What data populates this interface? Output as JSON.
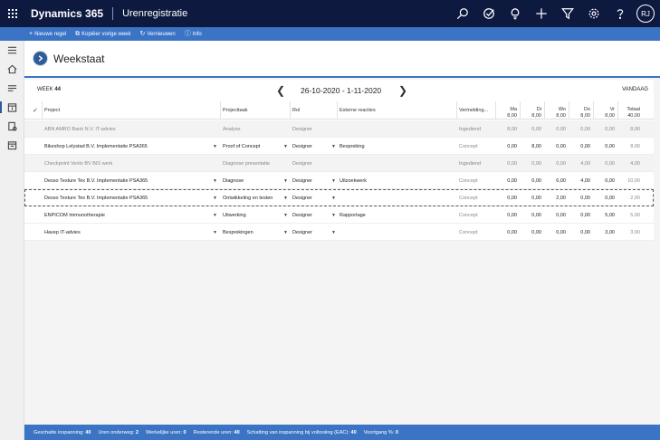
{
  "topbar": {
    "brand": "Dynamics 365",
    "app_name": "Urenregistratie",
    "avatar_initials": "RJ",
    "bg_color": "#0e1940"
  },
  "commands": [
    {
      "icon": "plus-icon",
      "label": "Nieuwe regel"
    },
    {
      "icon": "copy-icon",
      "label": "Kopiëer vorige week"
    },
    {
      "icon": "refresh-icon",
      "label": "Vernieuwen"
    },
    {
      "icon": "info-icon",
      "label": "Info"
    }
  ],
  "page": {
    "title": "Weekstaat",
    "accent_color": "#3b73c5"
  },
  "week": {
    "label": "WEEK",
    "number": "44",
    "range": "26-10-2020 - 1-11-2020",
    "today": "VANDAAG"
  },
  "columns": {
    "project": "Project",
    "task": "Projecttaak",
    "role": "Rol",
    "external": "Externe reacties",
    "mention": "Vermelding...",
    "days": [
      {
        "day": "Ma",
        "total": "8,00"
      },
      {
        "day": "Di",
        "total": "8,00"
      },
      {
        "day": "Wo",
        "total": "8,00"
      },
      {
        "day": "Do",
        "total": "8,00"
      },
      {
        "day": "Vr",
        "total": "8,00"
      }
    ],
    "total_label": "Totaal",
    "total_value": "40,00"
  },
  "rows": [
    {
      "project": "ABN AMRO Bank N.V. IT-advies",
      "task": "Analyse",
      "role": "Designer",
      "external": "",
      "status": "Ingediend",
      "values": [
        "8,00",
        "0,00",
        "0,00",
        "0,00",
        "0,00"
      ],
      "total": "8,00",
      "editable": false
    },
    {
      "project": "Bikeshop Lelystad B.V. Implementatie PSA365",
      "task": "Proof of Concept",
      "role": "Designer",
      "external": "Bespreking",
      "status": "Concept",
      "values": [
        "0,00",
        "8,00",
        "0,00",
        "0,00",
        "0,00"
      ],
      "total": "8,00",
      "editable": true
    },
    {
      "project": "Checkpoint Venlo BV BIS werk",
      "task": "Diagnose presentatie",
      "role": "Designer",
      "external": "",
      "status": "Ingediend",
      "values": [
        "0,00",
        "0,00",
        "0,00",
        "4,00",
        "0,00"
      ],
      "total": "4,00",
      "editable": false
    },
    {
      "project": "Desso Texture Tex B.V. Implementatie PSA365",
      "task": "Diagnose",
      "role": "Designer",
      "external": "Uitzoekwerk",
      "status": "Concept",
      "values": [
        "0,00",
        "0,00",
        "6,00",
        "4,00",
        "0,00"
      ],
      "total": "10,00",
      "editable": true
    },
    {
      "project": "Desso Texture Tex B.V. Implementatie PSA365",
      "task": "Ontwikkeling en testen",
      "role": "Designer",
      "external": "",
      "status": "Concept",
      "values": [
        "0,00",
        "0,00",
        "2,00",
        "0,00",
        "0,00"
      ],
      "total": "2,00",
      "editable": true
    },
    {
      "project": "ENPICOM Immunotherapie",
      "task": "Uitwerking",
      "role": "Designer",
      "external": "Rapportage",
      "status": "Concept",
      "values": [
        "0,00",
        "0,00",
        "0,00",
        "0,00",
        "5,00"
      ],
      "total": "5,00",
      "editable": true
    },
    {
      "project": "Havep IT-advies",
      "task": "Besprekingen",
      "role": "Designer",
      "external": "",
      "status": "Concept",
      "values": [
        "0,00",
        "0,00",
        "0,00",
        "0,00",
        "3,00"
      ],
      "total": "3,00",
      "editable": true
    }
  ],
  "footer": [
    {
      "label": "Geschatte inspanning:",
      "value": "40"
    },
    {
      "label": "Uren onderweg:",
      "value": "2"
    },
    {
      "label": "Werkelijke uren:",
      "value": "0"
    },
    {
      "label": "Resterende uren:",
      "value": "40"
    },
    {
      "label": "Schatting van inspanning bij voltooiing (EAC):",
      "value": "40"
    },
    {
      "label": "Voortgang %:",
      "value": "0"
    }
  ]
}
